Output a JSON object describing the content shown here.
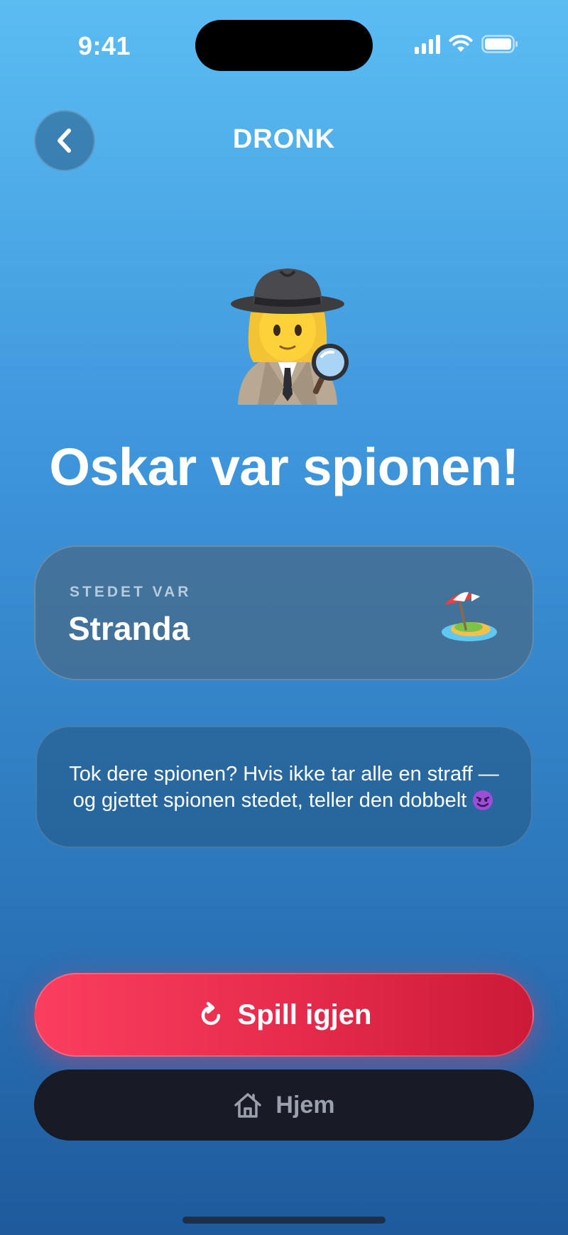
{
  "status_bar": {
    "time": "9:41"
  },
  "header": {
    "title": "DRONK",
    "back_icon": "chevron-left-icon"
  },
  "result": {
    "illustration_icon": "detective-emoji",
    "headline": "Oskar var spionen!"
  },
  "location_card": {
    "label": "STEDET VAR",
    "location": "Stranda",
    "icon": "beach-umbrella-island-emoji"
  },
  "hint": {
    "text": "Tok dere spionen? Hvis ikke tar alle en straff — og gjettet spionen stedet, teller den dobbelt",
    "icon": "smiling-devil-emoji"
  },
  "actions": {
    "play_again_label": "Spill igjen",
    "play_again_icon": "refresh-icon",
    "home_label": "Hjem",
    "home_icon": "house-icon"
  },
  "colors": {
    "background_top": "#5bbcf2",
    "background_bottom": "#1e5a9c",
    "primary_button": "#e52a4b",
    "secondary_button": "#181a25"
  }
}
